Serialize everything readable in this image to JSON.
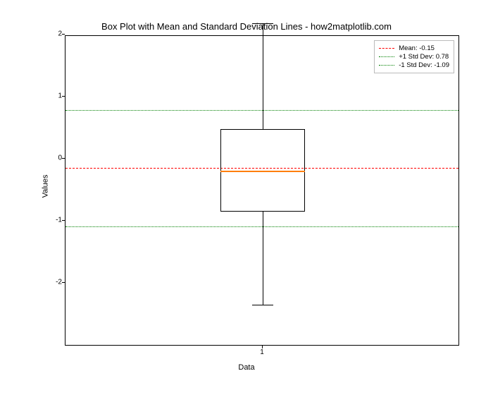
{
  "chart_data": {
    "type": "boxplot",
    "title": "Box Plot with Mean and Standard Deviation Lines - how2matplotlib.com",
    "xlabel": "Data",
    "ylabel": "Values",
    "x_ticks": [
      "1"
    ],
    "y_ticks": [
      -2,
      -1,
      0,
      1,
      2
    ],
    "ylim": [
      -2.55,
      2.45
    ],
    "series": [
      {
        "name": "1",
        "q1": -0.85,
        "median": -0.2,
        "q3": 0.48,
        "whisker_low": -2.35,
        "whisker_high": 2.18
      }
    ],
    "mean": -0.15,
    "std_plus": 0.78,
    "std_minus": -1.09,
    "legend": {
      "mean_label": "Mean: -0.15",
      "std_plus_label": "+1 Std Dev: 0.78",
      "std_minus_label": "-1 Std Dev: -1.09"
    }
  }
}
